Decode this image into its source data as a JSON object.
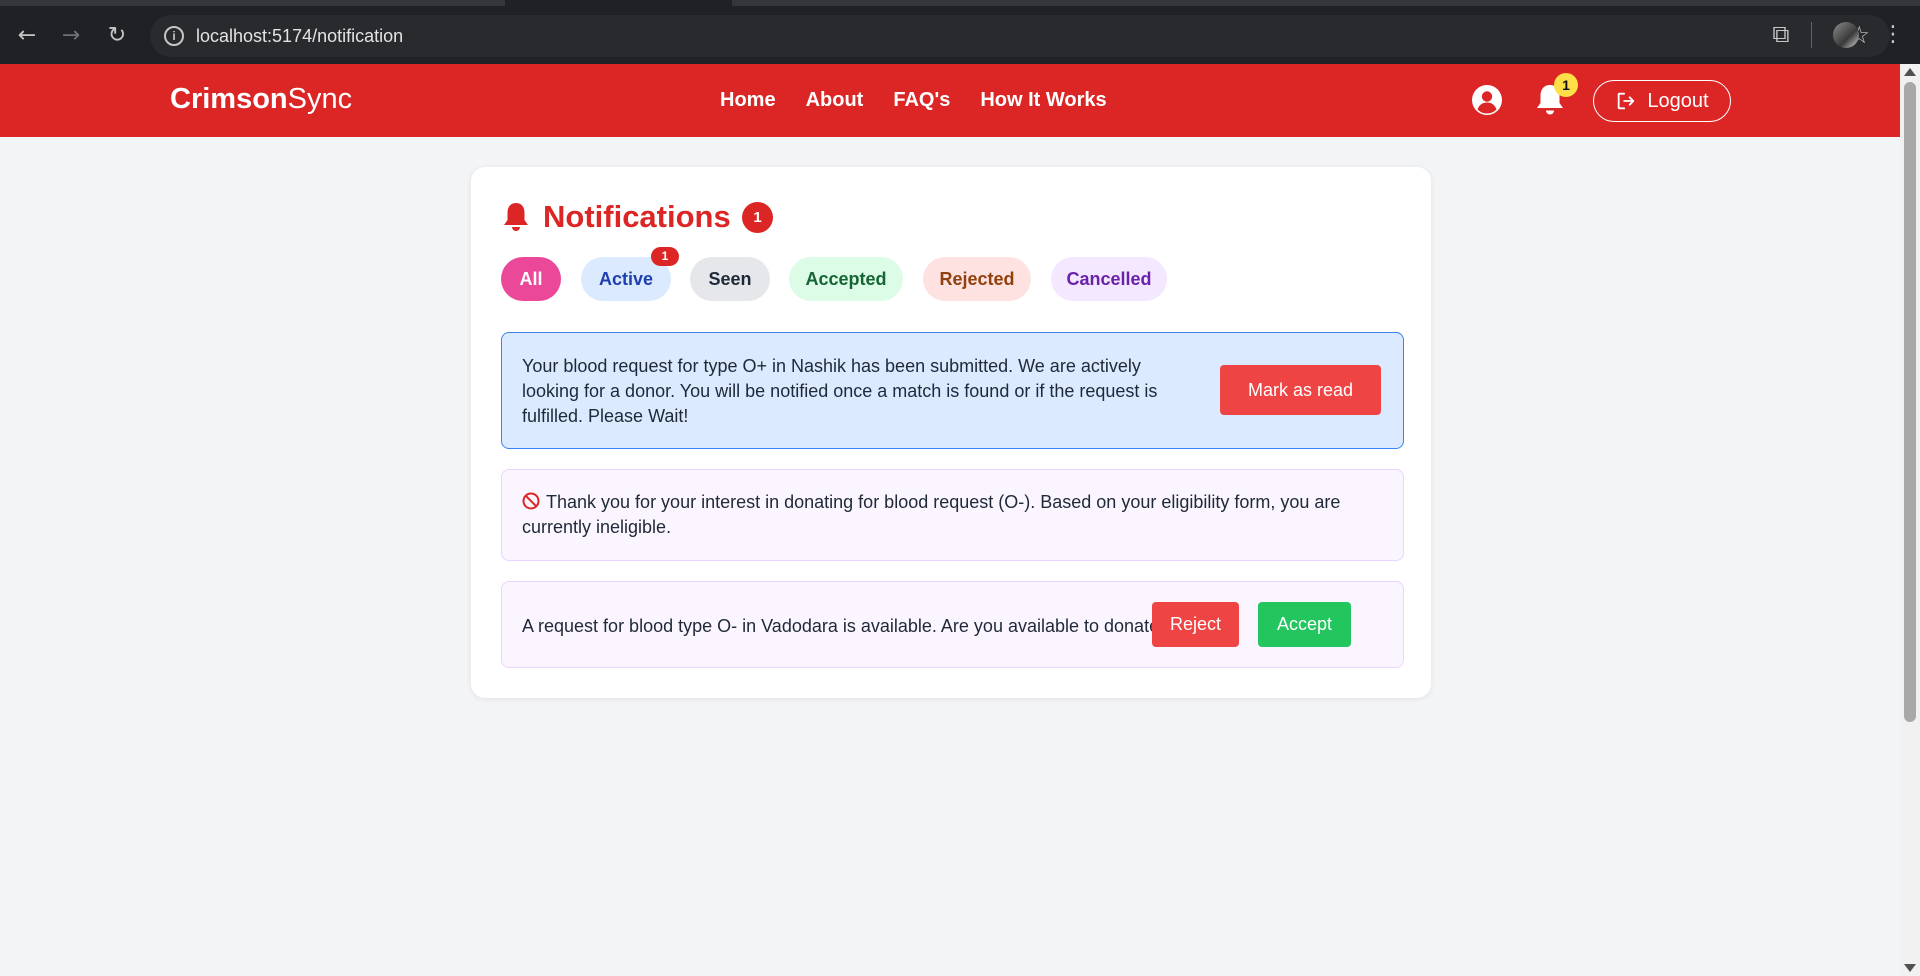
{
  "browser": {
    "url": "localhost:5174/notification",
    "info_icon": "info-icon",
    "back_icon": "←",
    "forward_icon": "→",
    "reload_icon": "↻",
    "star_icon": "☆",
    "extensions_icon": "⧉",
    "menu_icon": "⋮"
  },
  "header": {
    "brand_bold": "Crimson",
    "brand_light": "Sync",
    "nav": [
      "Home",
      "About",
      "FAQ's",
      "How It Works"
    ],
    "bell_count": "1",
    "logout_label": "Logout"
  },
  "notifications": {
    "title": "Notifications",
    "count": "1",
    "filters": {
      "all": "All",
      "active": "Active",
      "active_count": "1",
      "seen": "Seen",
      "accepted": "Accepted",
      "rejected": "Rejected",
      "cancelled": "Cancelled"
    },
    "items": [
      {
        "text": "Your blood request for type O+ in Nashik has been submitted. We are actively looking for a donor. You will be notified once a match is found or if the request is fulfilled. Please Wait!",
        "action": "Mark as read"
      },
      {
        "icon": "no-entry-icon",
        "text": "Thank you for your interest in donating for blood request (O-). Based on your eligibility form, you are currently ineligible."
      },
      {
        "text": "A request for blood type O- in Vadodara is available. Are you available to donate?",
        "reject": "Reject",
        "accept": "Accept"
      }
    ]
  },
  "colors": {
    "brand_red": "#dc2626",
    "pink_pill": "#ec4899",
    "accept_green": "#22c55e",
    "reject_red": "#ef4444",
    "badge_yellow": "#fde047"
  }
}
